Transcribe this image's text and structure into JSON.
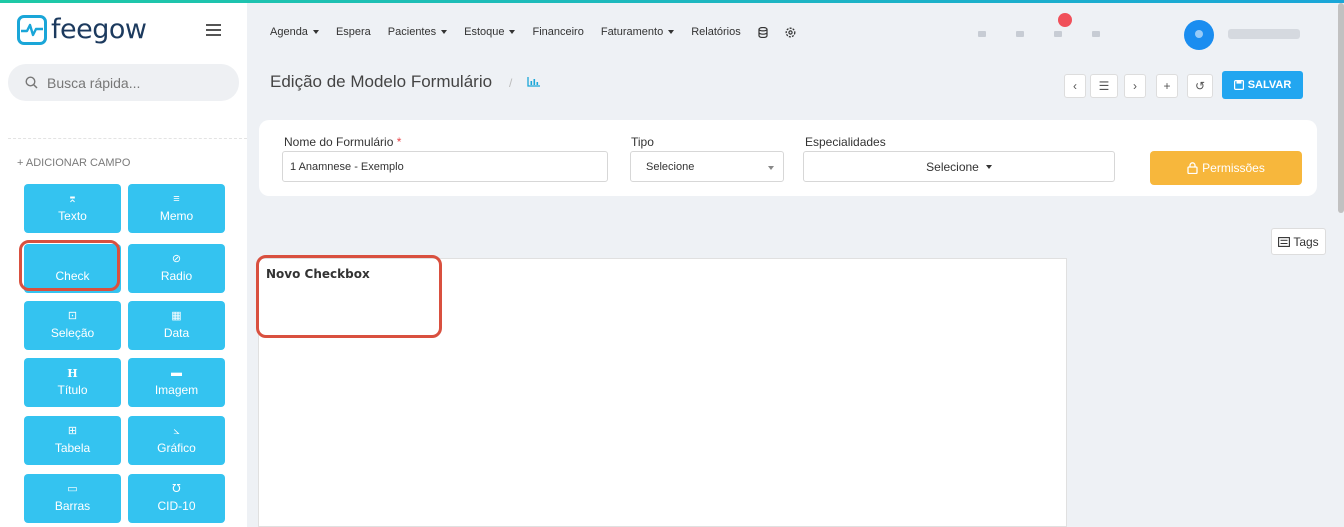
{
  "app": {
    "logo_text": "feegow"
  },
  "sidebar": {
    "search_placeholder": "Busca rápida...",
    "add_field_label": "+ ADICIONAR CAMPO",
    "fields": [
      {
        "label": "Texto",
        "icon": "text-icon"
      },
      {
        "label": "Memo",
        "icon": "memo-icon"
      },
      {
        "label": "Check",
        "icon": "check-icon"
      },
      {
        "label": "Radio",
        "icon": "radio-icon"
      },
      {
        "label": "Seleção",
        "icon": "select-icon"
      },
      {
        "label": "Data",
        "icon": "calendar-icon"
      },
      {
        "label": "Título",
        "icon": "heading-icon"
      },
      {
        "label": "Imagem",
        "icon": "image-icon"
      },
      {
        "label": "Tabela",
        "icon": "table-icon"
      },
      {
        "label": "Gráfico",
        "icon": "chart-icon"
      },
      {
        "label": "Barras",
        "icon": "barcode-icon"
      },
      {
        "label": "CID-10",
        "icon": "stethoscope-icon"
      }
    ]
  },
  "nav": {
    "items": [
      {
        "label": "Agenda",
        "dropdown": true
      },
      {
        "label": "Espera",
        "dropdown": false
      },
      {
        "label": "Pacientes",
        "dropdown": true
      },
      {
        "label": "Estoque",
        "dropdown": true
      },
      {
        "label": "Financeiro",
        "dropdown": false
      },
      {
        "label": "Faturamento",
        "dropdown": true
      },
      {
        "label": "Relatórios",
        "dropdown": false
      }
    ]
  },
  "header": {
    "title": "Edição de Modelo Formulário",
    "separator": "/",
    "save_label": "SALVAR"
  },
  "form": {
    "name_label": "Nome do Formulário",
    "name_required": "*",
    "name_value": "1 Anamnese - Exemplo",
    "type_label": "Tipo",
    "type_value": "Selecione",
    "specialties_label": "Especialidades",
    "specialties_value": "Selecione",
    "permissions_label": "Permissões"
  },
  "tags_label": "Tags",
  "canvas": {
    "field_title": "Novo Checkbox"
  },
  "colors": {
    "accent": "#22a6f0",
    "field_button": "#34c3f0",
    "highlight": "#d9503f",
    "warning": "#f7b73c"
  }
}
